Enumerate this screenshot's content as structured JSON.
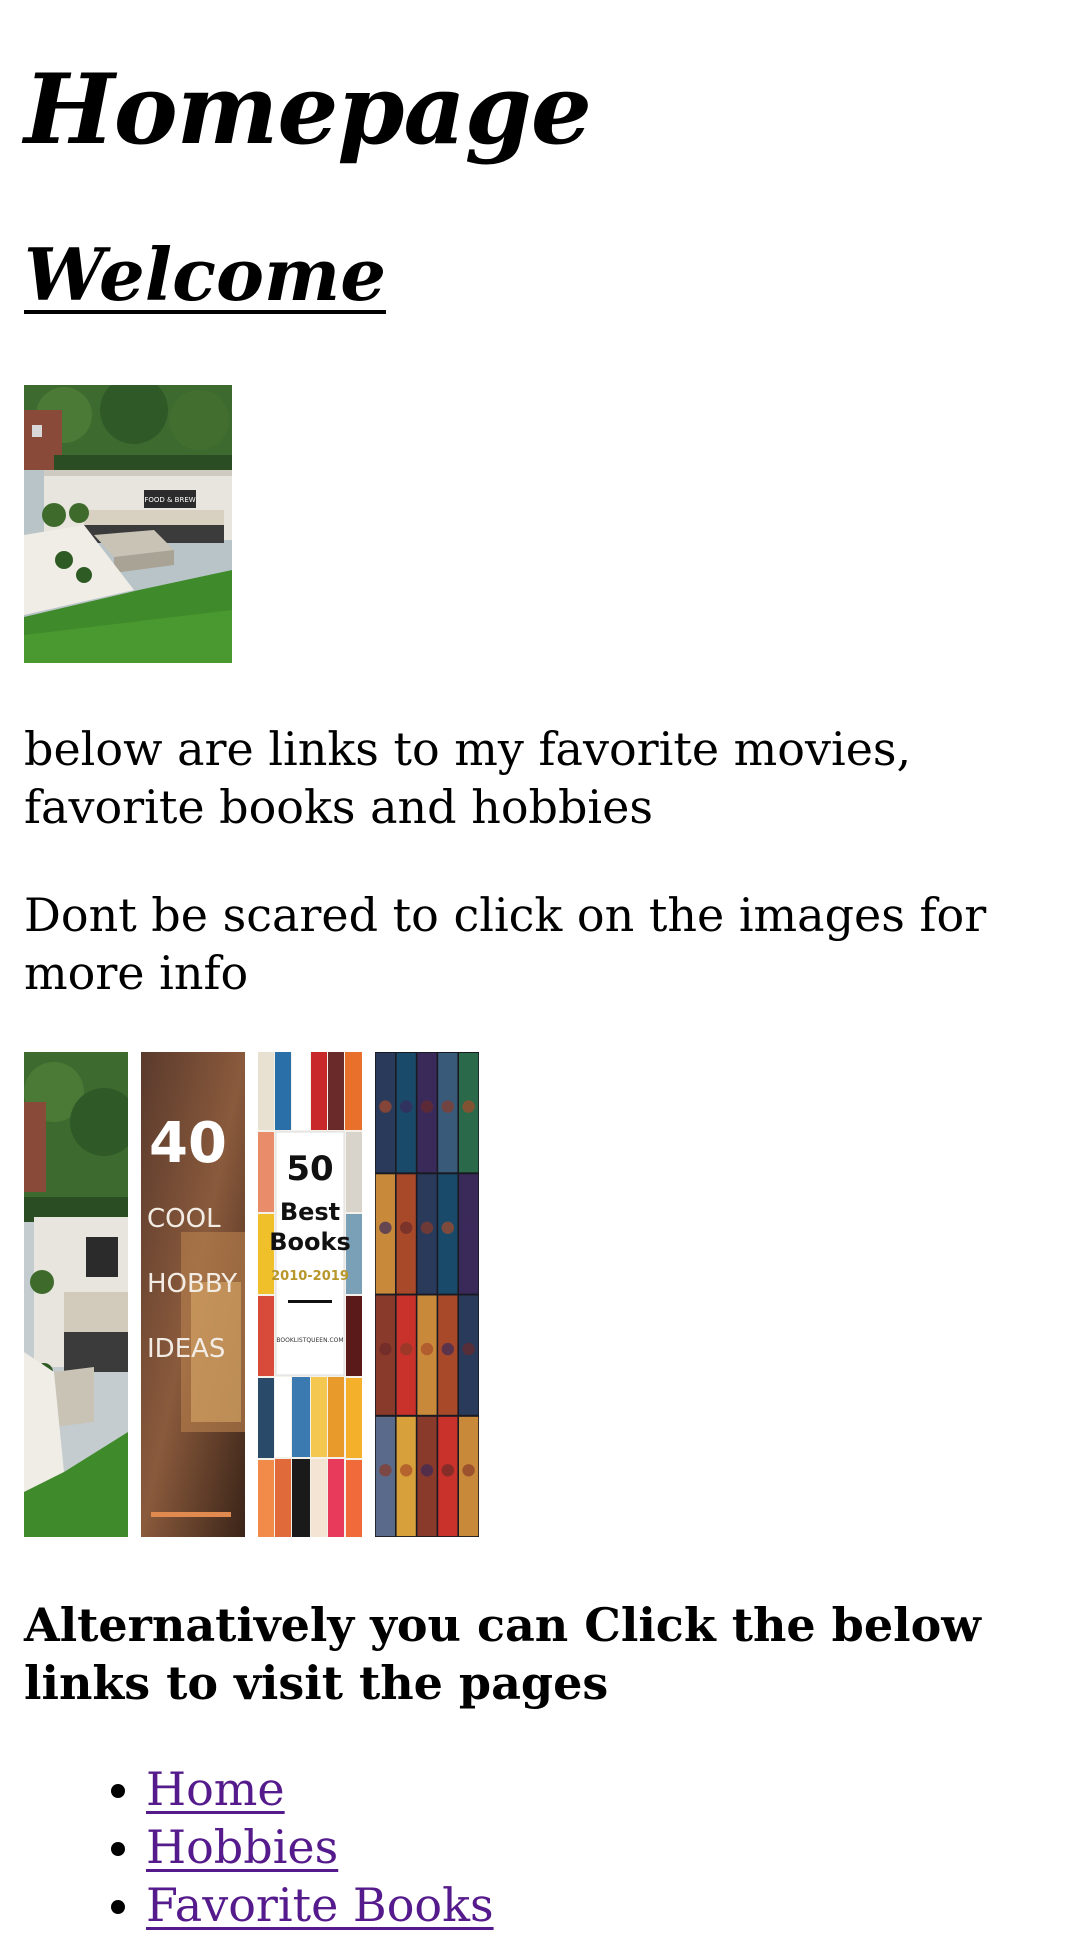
{
  "page": {
    "title": "Homepage",
    "welcome": "Welcome"
  },
  "hero_image": {
    "alt": "garden patio with sofa and fire pit",
    "overlay_text": "FOOD & BREW"
  },
  "intro_text": "below are links to my favorite movies, favorite books and hobbies",
  "scared_text": "Dont be scared to click on the images for more info",
  "thumbnails": [
    {
      "alt": "garden patio"
    },
    {
      "alt": "40 cool hobby ideas",
      "text_number": "40",
      "text_lines": [
        "COOL",
        "HOBBY",
        "IDEAS"
      ]
    },
    {
      "alt": "50 best books 2010-2019",
      "text_number": "50",
      "text_lines": [
        "Best",
        "Books"
      ],
      "years": "2010-2019",
      "site": "BOOKLISTQUEEN.COM"
    },
    {
      "alt": "movie posters collage"
    }
  ],
  "alt_heading": "Alternatively you can Click the below links to visit the pages",
  "links": [
    {
      "label": "Home"
    },
    {
      "label": "Hobbies"
    },
    {
      "label": "Favorite Books"
    }
  ],
  "colors": {
    "link_visited": "#551a8b",
    "grass": "#3f8a2a",
    "hedge": "#2f5a28"
  }
}
